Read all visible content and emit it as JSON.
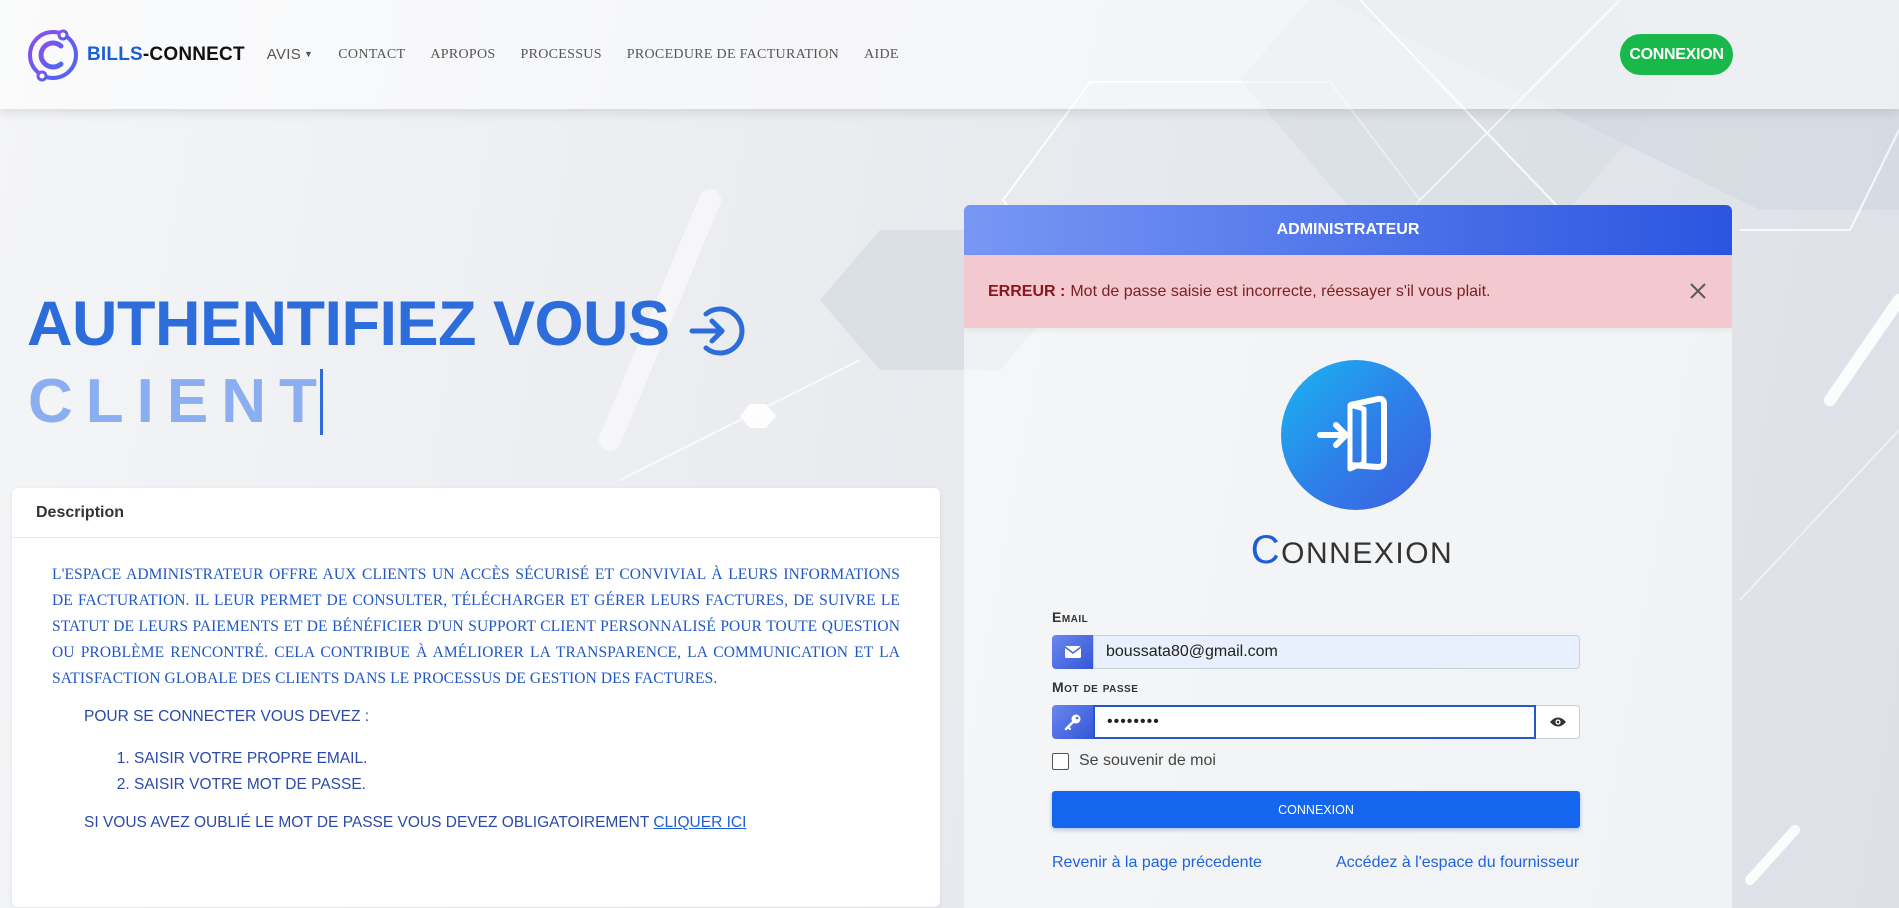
{
  "brand": {
    "name_part1": "BILLS",
    "name_part2": "-CONNECT"
  },
  "nav": {
    "items": [
      "AVIS",
      "CONTACT",
      "APROPOS",
      "PROCESSUS",
      "PROCEDURE DE FACTURATION",
      "AIDE"
    ],
    "connexion_button": "CONNEXION"
  },
  "hero": {
    "title": "AUTHENTIFIEZ VOUS",
    "subtitle": "CLIENT"
  },
  "description": {
    "header": "Description",
    "paragraph": "L'ESPACE ADMINISTRATEUR OFFRE AUX CLIENTS UN ACCÈS SÉCURISÉ ET CONVIVIAL À LEURS INFORMATIONS DE FACTURATION. IL LEUR PERMET DE CONSULTER, TÉLÉCHARGER ET GÉRER LEURS FACTURES, DE SUIVRE LE STATUT DE LEURS PAIEMENTS ET DE BÉNÉFICIER D'UN SUPPORT CLIENT PERSONNALISÉ POUR TOUTE QUESTION OU PROBLÈME RENCONTRÉ. CELA CONTRIBUE À AMÉLIORER LA TRANSPARENCE, LA COMMUNICATION ET LA SATISFACTION GLOBALE DES CLIENTS DANS LE PROCESSUS DE GESTION DES FACTURES.",
    "intro": "POUR SE CONNECTER VOUS DEVEZ :",
    "steps": [
      "SAISIR VOTRE PROPRE EMAIL.",
      "SAISIR VOTRE MOT DE PASSE."
    ],
    "forgot_text": "SI VOUS AVEZ OUBLIÉ LE MOT DE PASSE VOUS DEVEZ OBLIGATOIREMENT",
    "forgot_link": "CLIQUER ICI"
  },
  "login": {
    "panel_title": "ADMINISTRATEUR",
    "error_label": "ERREUR :",
    "error_message": "Mot de passe saisie est incorrecte, réessayer s'il vous plait.",
    "title_first": "C",
    "title_rest": "ONNEXION",
    "email_label": "Email",
    "email_value": "boussata80@gmail.com",
    "password_label": "Mot de passe",
    "password_value": "password",
    "remember_label": "Se souvenir de moi",
    "submit_label": "CONNEXION",
    "back_link": "Revenir à la page précedente",
    "supplier_link": "Accédez à l'espace du fournisseur"
  },
  "colors": {
    "brand_blue": "#1a5fd6",
    "connexion_green": "#18b84a",
    "error_bg": "#f3c9cf",
    "submit_blue": "#1466ef"
  }
}
